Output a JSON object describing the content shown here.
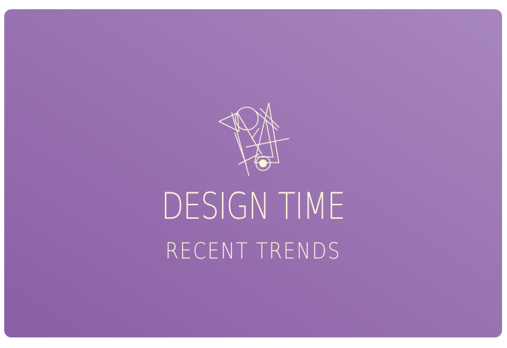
{
  "colors": {
    "background_start": "#8a5fa5",
    "background_end": "#a886bd",
    "text": "#fbf6d8",
    "page": "#ffffff"
  },
  "banner": {
    "logo_icon": "abstract-geometric-lines-logo",
    "title": "DESIGN TIME",
    "subtitle": "RECENT TRENDS"
  }
}
